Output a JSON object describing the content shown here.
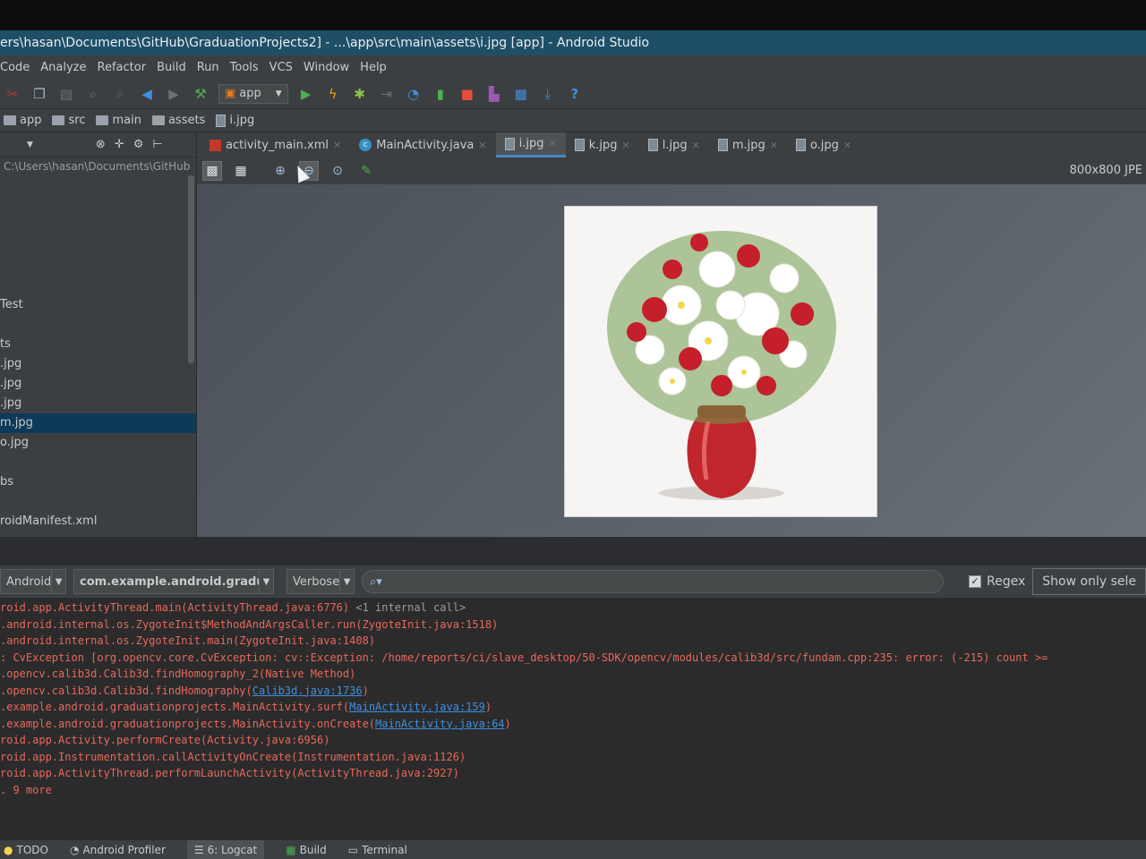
{
  "window": {
    "title": "ers\\hasan\\Documents\\GitHub\\GraduationProjects2] - ...\\app\\src\\main\\assets\\i.jpg [app] - Android Studio"
  },
  "menu": [
    "Code",
    "Analyze",
    "Refactor",
    "Build",
    "Run",
    "Tools",
    "VCS",
    "Window",
    "Help"
  ],
  "toolbar": {
    "run_config": "app",
    "help": "?"
  },
  "breadcrumbs": [
    "app",
    "src",
    "main",
    "assets",
    "i.jpg"
  ],
  "sidebar": {
    "path": "C:\\Users\\hasan\\Documents\\GitHub",
    "items": [
      {
        "label": "Test",
        "selected": false
      },
      {
        "label": "ts",
        "selected": false
      },
      {
        "label": ".jpg",
        "selected": false
      },
      {
        "label": ".jpg",
        "selected": false
      },
      {
        "label": ".jpg",
        "selected": false
      },
      {
        "label": "m.jpg",
        "selected": true
      },
      {
        "label": "o.jpg",
        "selected": false
      },
      {
        "label": "bs",
        "selected": false
      },
      {
        "label": "roidManifest.xml",
        "selected": false
      }
    ]
  },
  "tabs": [
    {
      "label": "activity_main.xml",
      "type": "xml",
      "active": false
    },
    {
      "label": "MainActivity.java",
      "type": "class",
      "active": false
    },
    {
      "label": "i.jpg",
      "type": "image",
      "active": true
    },
    {
      "label": "k.jpg",
      "type": "image",
      "active": false
    },
    {
      "label": "l.jpg",
      "type": "image",
      "active": false
    },
    {
      "label": "m.jpg",
      "type": "image",
      "active": false
    },
    {
      "label": "o.jpg",
      "type": "image",
      "active": false
    }
  ],
  "image_viewer": {
    "size_label": "800x800 JPE"
  },
  "logcat": {
    "device": "Android",
    "package": "com.example.android.graduatio",
    "level": "Verbose",
    "search_placeholder": "",
    "regex_label": "Regex",
    "regex_checked": true,
    "show_only_label": "Show only sele",
    "lines": [
      {
        "text": "roid.app.ActivityThread.main(ActivityThread.java:6776) ",
        "link": "",
        "suffix": "<1 internal call>"
      },
      {
        "text": ".android.internal.os.ZygoteInit$MethodAndArgsCaller.run(ZygoteInit.java:1518)",
        "link": "",
        "suffix": ""
      },
      {
        "text": ".android.internal.os.ZygoteInit.main(ZygoteInit.java:1408)",
        "link": "",
        "suffix": ""
      },
      {
        "text": ": CvException [org.opencv.core.CvException: cv::Exception: /home/reports/ci/slave_desktop/50-SDK/opencv/modules/calib3d/src/fundam.cpp:235: error: (-215) count >=",
        "link": "",
        "suffix": ""
      },
      {
        "text": ".opencv.calib3d.Calib3d.findHomography_2(Native Method)",
        "link": "",
        "suffix": ""
      },
      {
        "text": ".opencv.calib3d.Calib3d.findHomography(",
        "link": "Calib3d.java:1736",
        "suffix": ")"
      },
      {
        "text": ".example.android.graduationprojects.MainActivity.surf(",
        "link": "MainActivity.java:159",
        "suffix": ")"
      },
      {
        "text": ".example.android.graduationprojects.MainActivity.onCreate(",
        "link": "MainActivity.java:64",
        "suffix": ")"
      },
      {
        "text": "roid.app.Activity.performCreate(Activity.java:6956)",
        "link": "",
        "suffix": ""
      },
      {
        "text": "roid.app.Instrumentation.callActivityOnCreate(Instrumentation.java:1126)",
        "link": "",
        "suffix": ""
      },
      {
        "text": "roid.app.ActivityThread.performLaunchActivity(ActivityThread.java:2927)",
        "link": "",
        "suffix": ""
      },
      {
        "text": ". 9 more",
        "link": "",
        "suffix": ""
      }
    ]
  },
  "status_tabs": [
    {
      "label": "TODO",
      "active": false
    },
    {
      "label": "Android Profiler",
      "active": false
    },
    {
      "label": "6: Logcat",
      "active": true
    },
    {
      "label": "Build",
      "active": false
    },
    {
      "label": "Terminal",
      "active": false
    }
  ],
  "colors": {
    "accent": "#4a88c7",
    "error_text": "#e8685b",
    "link": "#3f8fe0",
    "selection": "#0d3a58"
  }
}
